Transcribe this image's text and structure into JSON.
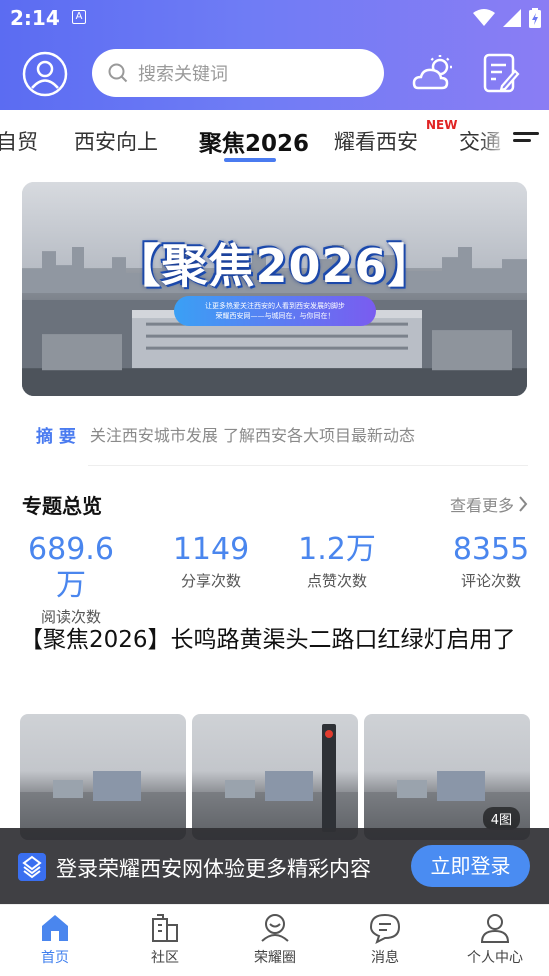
{
  "status_bar": {
    "time": "2:14",
    "a_icon": "A"
  },
  "header": {
    "search_placeholder": "搜索关键词"
  },
  "tabs": [
    {
      "label": "自贸"
    },
    {
      "label": "西安向上"
    },
    {
      "label": "聚焦2026"
    },
    {
      "label": "耀看西安"
    },
    {
      "label": "交通"
    }
  ],
  "new_badge": "NEW",
  "banner": {
    "title": "【聚焦2026】",
    "pill_line1": "让更多热爱关注西安的人看到西安发展的脚步",
    "pill_line2": "荣耀西安网——与城同在，与你同在！"
  },
  "summary": {
    "tag": "摘 要",
    "text": "关注西安城市发展 了解西安各大项目最新动态"
  },
  "topic": {
    "heading": "专题总览",
    "more": "查看更多"
  },
  "stats": [
    {
      "value": "689.6万",
      "label": "阅读次数"
    },
    {
      "value": "1149",
      "label": "分享次数"
    },
    {
      "value": "1.2万",
      "label": "点赞次数"
    },
    {
      "value": "8355",
      "label": "评论次数"
    }
  ],
  "article": {
    "title": "【聚焦2026】长鸣路黄渠头二路口红绿灯启用了",
    "image_count": "4图"
  },
  "login_bar": {
    "message": "登录荣耀西安网体验更多精彩内容",
    "button": "立即登录"
  },
  "bottom_nav": [
    {
      "label": "首页"
    },
    {
      "label": "社区"
    },
    {
      "label": "荣耀圈"
    },
    {
      "label": "消息"
    },
    {
      "label": "个人中心"
    }
  ],
  "colors": {
    "accent": "#4a7bf0",
    "stat_number": "#4a86ee",
    "header_gradient_start": "#5b6cf2",
    "header_gradient_end": "#8a7df4",
    "new_badge": "#e02424"
  }
}
